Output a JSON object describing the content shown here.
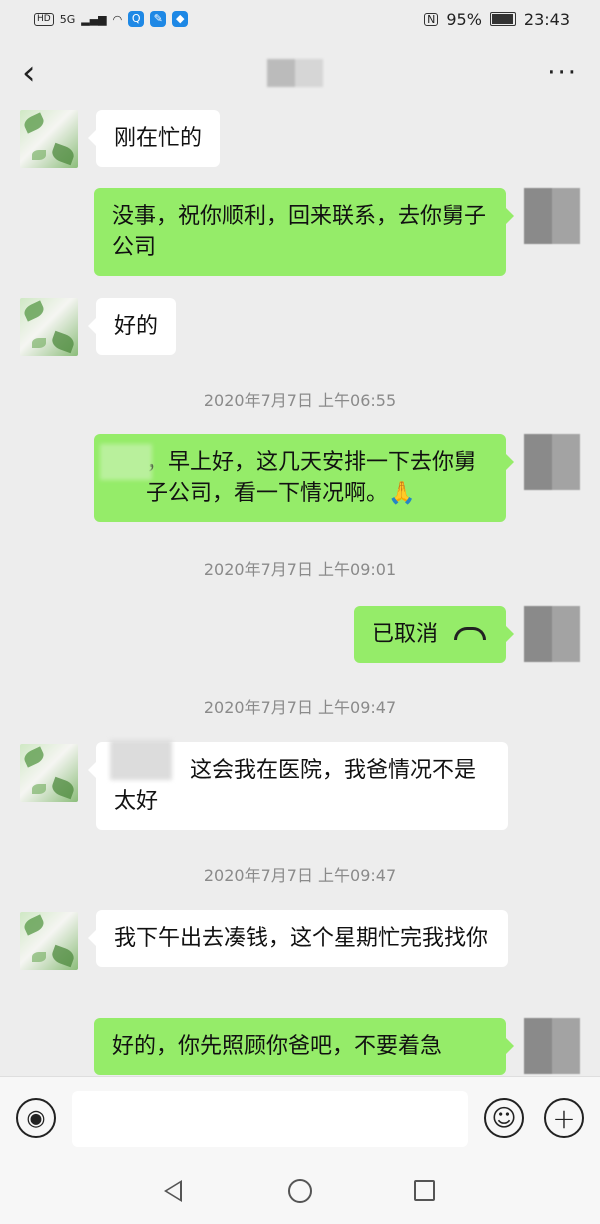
{
  "status_bar": {
    "hd": "HD",
    "network": "5G",
    "battery": "95%",
    "battery_level": 0.95,
    "time": "23:43"
  },
  "header": {
    "back_icon": "‹",
    "more_icon": "···"
  },
  "messages": [
    {
      "side": "left",
      "text": "刚在忙的"
    },
    {
      "side": "right",
      "text": "没事，祝你顺利，回来联系，去你舅子公司"
    },
    {
      "side": "left",
      "text": "好的"
    },
    {
      "type": "timestamp",
      "text": "2020年7月7日 上午06:55"
    },
    {
      "side": "right",
      "text": "，早上好，这几天安排一下去你舅子公司，看一下情况啊。🙏"
    },
    {
      "type": "timestamp",
      "text": "2020年7月7日 上午09:01"
    },
    {
      "side": "right",
      "text": "已取消"
    },
    {
      "type": "timestamp",
      "text": "2020年7月7日 上午09:47"
    },
    {
      "side": "left",
      "text": "这会我在医院，我爸情况不是太好"
    },
    {
      "type": "timestamp",
      "text": "2020年7月7日 上午09:47"
    },
    {
      "side": "left",
      "text": "我下午出去凑钱，这个星期忙完我找你"
    },
    {
      "side": "right",
      "text": "好的，你先照顾你爸吧，不要着急"
    }
  ],
  "input_bar": {
    "voice_icon": "voice-icon",
    "emoji_icon": "emoji-icon",
    "plus_icon": "plus-icon",
    "placeholder": ""
  },
  "colors": {
    "background": "#ededed",
    "bubble_self": "#95ec69",
    "bubble_other": "#ffffff",
    "timestamp": "#8a8a8a"
  }
}
